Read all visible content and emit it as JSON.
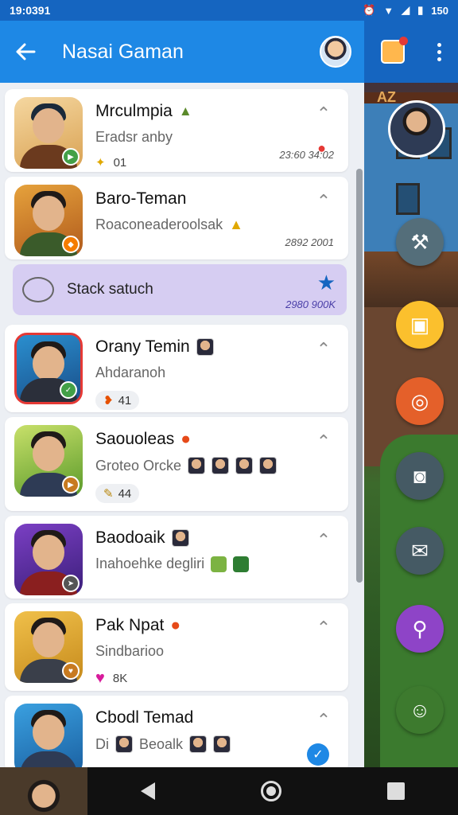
{
  "status_bar": {
    "time": "19:0391",
    "battery": "150"
  },
  "header": {
    "title": "Nasai Gaman"
  },
  "colors": {
    "app_bar": "#1e88e5",
    "status_bar": "#1565c0",
    "search_card": "#d6cdf2",
    "accent_star": "#1565c0"
  },
  "chats": [
    {
      "name": "Mrculmpia",
      "message": "Eradsr anby",
      "meta": "01",
      "time": "23:60 34:02"
    },
    {
      "name": "Baro-Teman",
      "message": "Roaconeaderoolsak",
      "time": "2892 2001"
    },
    {
      "name": "Orany Temin",
      "message": "Ahdaranoh",
      "meta": "41"
    },
    {
      "name": "Saouoleas",
      "message": "Groteo Orcke",
      "meta": "44"
    },
    {
      "name": "Baodoaik",
      "message": "Inahoehke degliri"
    },
    {
      "name": "Pak Npat",
      "message": "Sindbarioo",
      "meta": "8K"
    },
    {
      "name": "Cbodl Temad",
      "message": "Di",
      "meta": "Beoalk"
    }
  ],
  "search_row": {
    "label": "Stack satuch",
    "time": "2980 900K"
  },
  "right_badge": "AZ",
  "icons": {
    "back": "arrow-left-icon",
    "menu": "kebab-menu-icon",
    "collapse": "caret-up-icon",
    "star": "star-icon",
    "nav_back": "triangle-back-icon",
    "nav_home": "circle-home-icon",
    "nav_recent": "square-recent-icon"
  }
}
